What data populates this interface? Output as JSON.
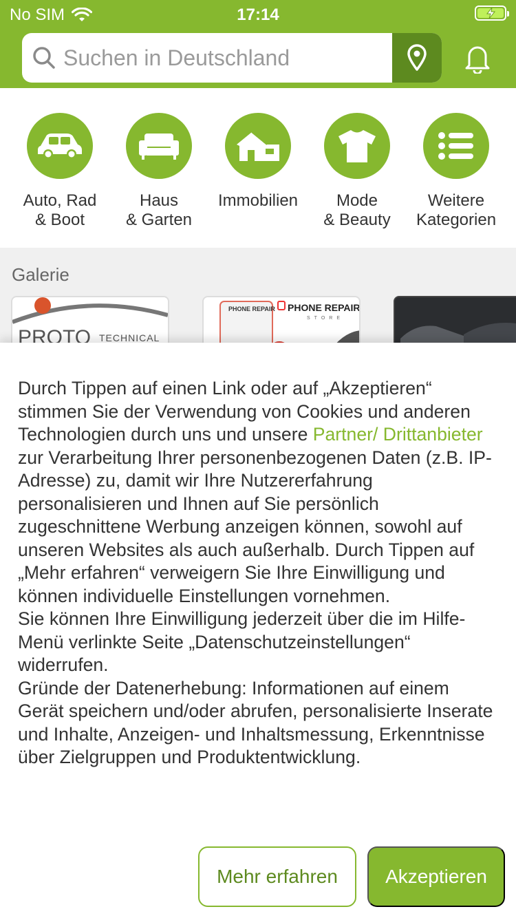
{
  "status_bar": {
    "carrier": "No SIM",
    "time": "17:14"
  },
  "search": {
    "placeholder": "Suchen in Deutschland"
  },
  "categories": [
    {
      "label": "Auto, Rad\n& Boot",
      "icon": "car-icon"
    },
    {
      "label": "Haus\n& Garten",
      "icon": "sofa-icon"
    },
    {
      "label": "Immobilien",
      "icon": "house-icon"
    },
    {
      "label": "Mode\n& Beauty",
      "icon": "tshirt-icon"
    },
    {
      "label": "Weitere\nKategorien",
      "icon": "list-icon"
    }
  ],
  "gallery": {
    "title": "Galerie",
    "tiles": [
      {
        "text_main": "PROTO",
        "text_sub": "TECHNICAL"
      },
      {
        "text_a": "PHONE REPAIR",
        "text_b": "PHONE REPAIR",
        "text_c": "STORE"
      },
      {
        "text": ""
      }
    ]
  },
  "consent": {
    "part1": "Durch Tippen auf einen Link oder auf „Akzeptieren“ stimmen Sie der Verwendung von Cookies und anderen Technologien durch uns und unsere ",
    "link": "Partner/ Drittanbieter",
    "part2": " zur Verarbeitung Ihrer personenbezogenen Daten (z.B. IP-Adresse) zu, damit wir Ihre Nutzererfahrung personalisieren und Ihnen auf Sie persönlich zugeschnittene Werbung anzeigen können, sowohl auf unseren Websites als auch außerhalb. Durch Tippen auf „Mehr erfahren“ verweigern Sie Ihre Einwilligung und können individuelle Einstellungen vornehmen.",
    "part3": "Sie können Ihre Einwilligung jederzeit über die im Hilfe-Menü verlinkte Seite „Datenschutzeinstellungen“ widerrufen.",
    "part4": "Gründe der Datenerhebung: Informationen auf einem Gerät speichern und/oder abrufen, personalisierte Inserate und Inhalte, Anzeigen- und Inhaltsmessung, Erkenntnisse über Zielgruppen und Produktentwicklung."
  },
  "buttons": {
    "more": "Mehr erfahren",
    "accept": "Akzeptieren"
  },
  "colors": {
    "brand_green": "#86b82f",
    "dark_green": "#5d8a1f"
  }
}
